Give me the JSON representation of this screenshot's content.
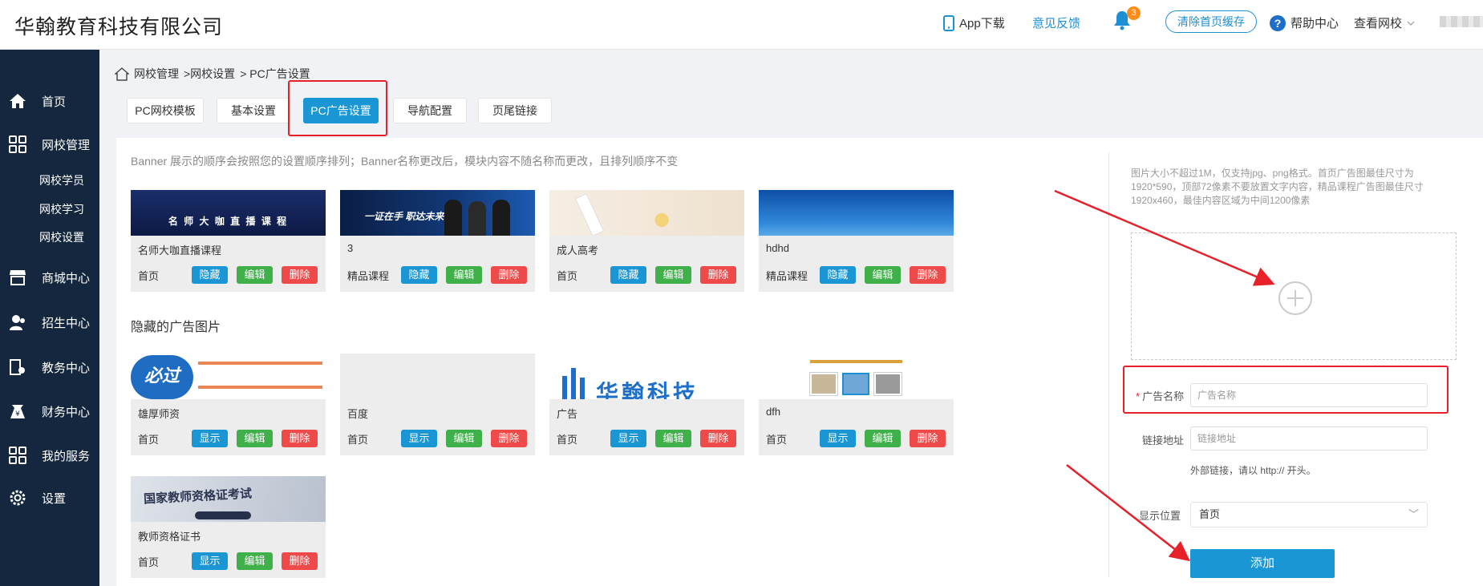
{
  "header": {
    "company": "华翰教育科技有限公司",
    "app_download": "App下载",
    "feedback": "意见反馈",
    "notification_count": "3",
    "clear_cache": "清除首页缓存",
    "help": "帮助中心",
    "view_school": "查看网校"
  },
  "sidebar": {
    "items": [
      {
        "label": "首页",
        "icon": "home-icon"
      },
      {
        "label": "网校管理",
        "icon": "grid-icon"
      },
      {
        "label": "商城中心",
        "icon": "store-icon"
      },
      {
        "label": "招生中心",
        "icon": "users-icon"
      },
      {
        "label": "教务中心",
        "icon": "teaching-icon"
      },
      {
        "label": "财务中心",
        "icon": "finance-icon"
      },
      {
        "label": "我的服务",
        "icon": "grid-icon"
      },
      {
        "label": "设置",
        "icon": "gear-icon"
      }
    ],
    "subitems": [
      "网校学员",
      "网校学习",
      "网校设置"
    ]
  },
  "breadcrumb": {
    "parts": [
      "网校管理",
      ">网校设置",
      "> PC广告设置"
    ]
  },
  "tabs": [
    "PC网校模板",
    "基本设置",
    "PC广告设置",
    "导航配置",
    "页尾链接"
  ],
  "main": {
    "hint": "Banner 展示的顺序会按照您的设置顺序排列；Banner名称更改后，模块内容不随名称而更改，且排列顺序不变",
    "hidden_title": "隐藏的广告图片",
    "buttons": {
      "hide": "隐藏",
      "show": "显示",
      "edit": "编辑",
      "delete": "删除"
    },
    "visible_cards": [
      {
        "name": "名师大咖直播课程",
        "location": "首页",
        "thumb_text": "名 师 大 咖 直 播 课 程"
      },
      {
        "name": "3",
        "location": "精品课程",
        "thumb_text": "一证在手 职达未来"
      },
      {
        "name": "成人高考",
        "location": "首页",
        "thumb_text": ""
      },
      {
        "name": "hdhd",
        "location": "精品课程",
        "thumb_text": ""
      }
    ],
    "hidden_cards": [
      {
        "name": "雄厚师资",
        "location": "首页",
        "thumb_text": "必过"
      },
      {
        "name": "百度",
        "location": "首页",
        "thumb_text": ""
      },
      {
        "name": "广告",
        "location": "首页",
        "thumb_text": "华翰科技"
      },
      {
        "name": "dfh",
        "location": "首页",
        "thumb_text": ""
      },
      {
        "name": "教师资格证书",
        "location": "首页",
        "thumb_text": "国家教师资格证考试"
      }
    ]
  },
  "form": {
    "rule": "图片大小不超过1M，仅支持jpg、png格式。首页广告图最佳尺寸为1920*590，顶部72像素不要放置文字内容，精品课程广告图最佳尺寸1920x460，最佳内容区域为中间1200像素",
    "name_label": "广告名称",
    "name_placeholder": "广告名称",
    "link_label": "链接地址",
    "link_placeholder": "链接地址",
    "link_tip": "外部链接，请以 http:// 开头。",
    "position_label": "显示位置",
    "position_value": "首页",
    "add_button": "添加"
  },
  "colors": {
    "primary": "#1a96d5",
    "green": "#3fb04a",
    "red": "#ef4a4a",
    "sidebar": "#14273e",
    "annotation": "#e8202a"
  }
}
